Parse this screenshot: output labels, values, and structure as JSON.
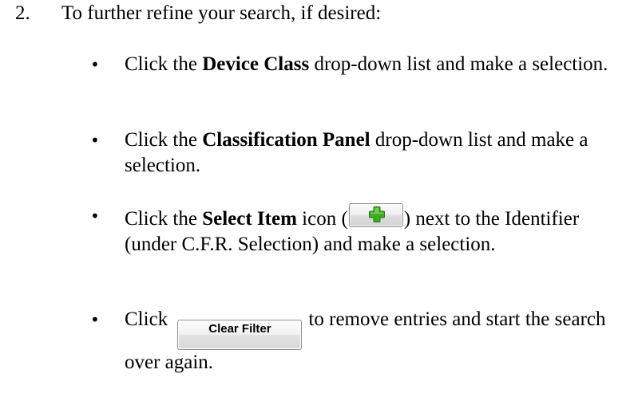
{
  "step": {
    "number": "2.",
    "intro": "To further refine your search, if desired:"
  },
  "bullets": [
    {
      "symbol": "•",
      "lead": "Click the ",
      "bold": "Device Class",
      "rest": " drop-down list and make a selection."
    },
    {
      "symbol": "•",
      "lead": "Click the ",
      "bold": "Classification Panel",
      "rest": " drop-down list and make a selection."
    },
    {
      "symbol": "•",
      "lead": "Click the ",
      "bold": "Select Item",
      "before_icon": " icon (",
      "after_icon": ") next to the Identifier (under C.F.R. Selection) and make a selection.",
      "icon": "green-plus-icon",
      "icon_color": "#3daa1f"
    },
    {
      "symbol": "•",
      "lead": "Click ",
      "button_label": "Clear Filter",
      "rest": "to remove entries and start the search over again."
    }
  ]
}
